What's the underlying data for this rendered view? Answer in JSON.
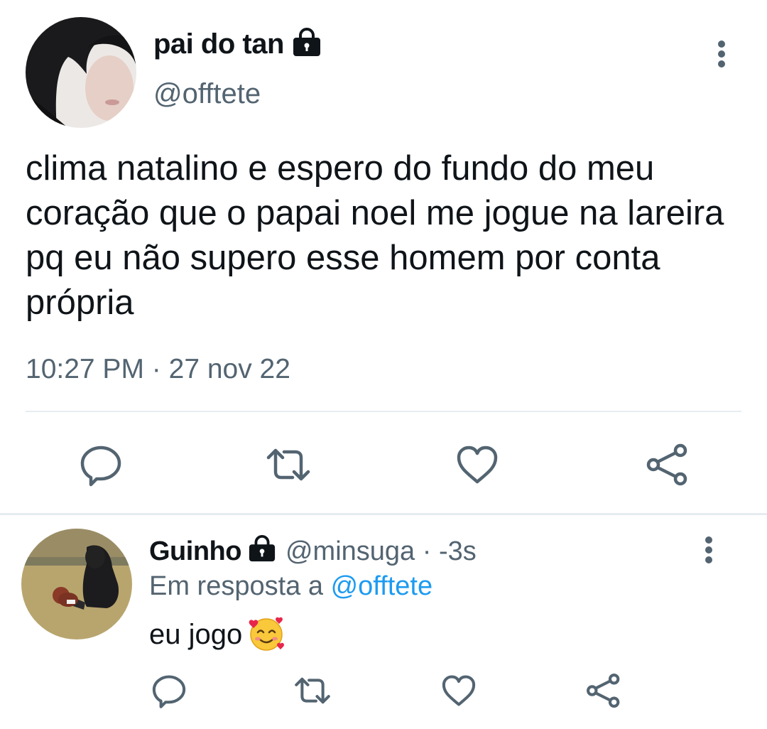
{
  "tweet": {
    "author_name": "pai do tan",
    "author_handle": "@offtete",
    "avatar_icon": "avatar-photo",
    "protected_icon": "lock-icon",
    "text": "clima natalino e espero do fundo do meu coração que o papai noel me jogue na lareira pq eu não supero esse homem por conta própria",
    "time": "10:27 PM",
    "separator": "·",
    "date": "27 nov 22",
    "actions": [
      "reply-icon",
      "retweet-icon",
      "like-icon",
      "share-icon"
    ]
  },
  "reply": {
    "author_name": "Guinho",
    "author_handle": "@minsuga",
    "meta_separator": "·",
    "age": "-3s",
    "in_reply_prefix": "Em resposta a",
    "in_reply_to": "@offtete",
    "text": "eu jogo",
    "emoji": "smiling-face-with-hearts",
    "actions": [
      "reply-icon",
      "retweet-icon",
      "like-icon",
      "share-icon"
    ]
  },
  "colors": {
    "text": "#0f1419",
    "secondary": "#536471",
    "link": "#1d9bf0",
    "divider": "#e6ecf0"
  }
}
